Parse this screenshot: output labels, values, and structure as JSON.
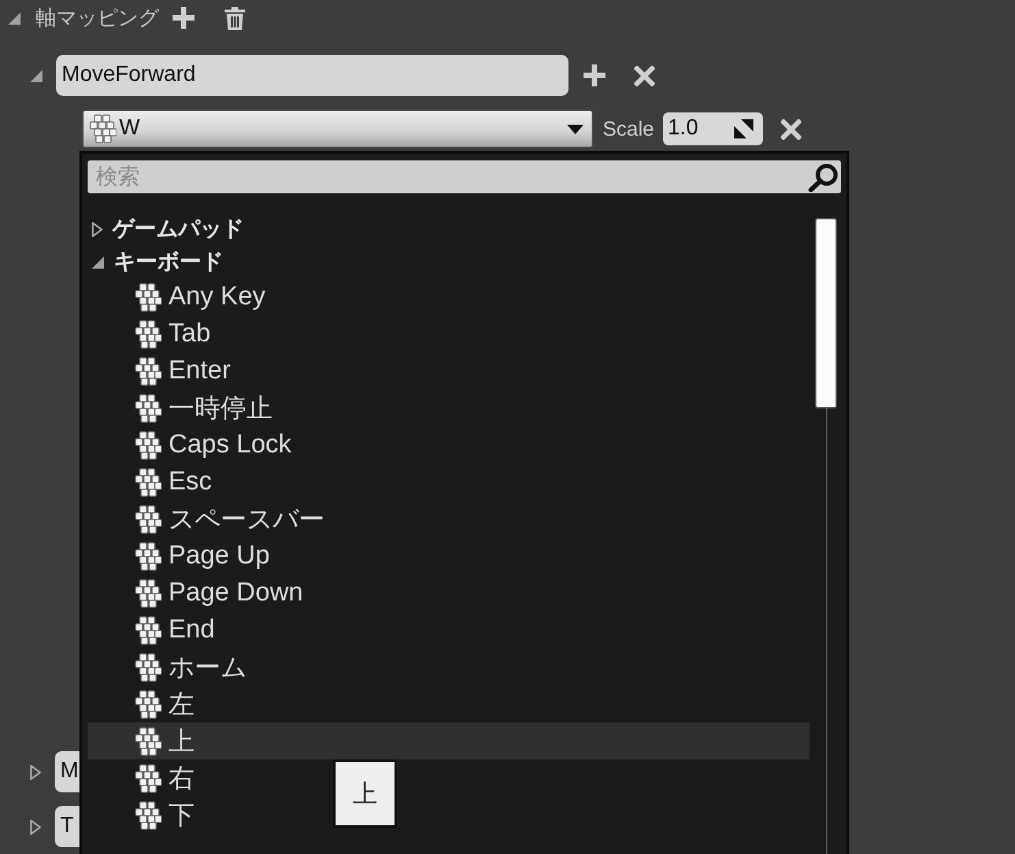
{
  "section": {
    "title": "軸マッピング",
    "expanded": true
  },
  "mappings": [
    {
      "name": "MoveForward",
      "expanded": true,
      "keys": [
        {
          "key": "W",
          "scale_label": "Scale",
          "scale": "1.0"
        }
      ]
    },
    {
      "name": "M",
      "expanded": false
    },
    {
      "name": "T",
      "expanded": false
    }
  ],
  "key_picker": {
    "search": {
      "placeholder": "検索"
    },
    "categories": [
      {
        "label": "ゲームパッド",
        "expanded": false
      },
      {
        "label": "キーボード",
        "expanded": true,
        "children": [
          {
            "label": "Any Key",
            "selected": false
          },
          {
            "label": "Tab",
            "selected": false
          },
          {
            "label": "Enter",
            "selected": false
          },
          {
            "label": "一時停止",
            "selected": false
          },
          {
            "label": "Caps Lock",
            "selected": false
          },
          {
            "label": "Esc",
            "selected": false
          },
          {
            "label": "スペースバー",
            "selected": false
          },
          {
            "label": "Page Up",
            "selected": false
          },
          {
            "label": "Page Down",
            "selected": false
          },
          {
            "label": "End",
            "selected": false
          },
          {
            "label": "ホーム",
            "selected": false
          },
          {
            "label": "左",
            "selected": false
          },
          {
            "label": "上",
            "selected": true
          },
          {
            "label": "右",
            "selected": false
          },
          {
            "label": "下",
            "selected": false
          }
        ]
      }
    ],
    "tooltip": "上"
  }
}
